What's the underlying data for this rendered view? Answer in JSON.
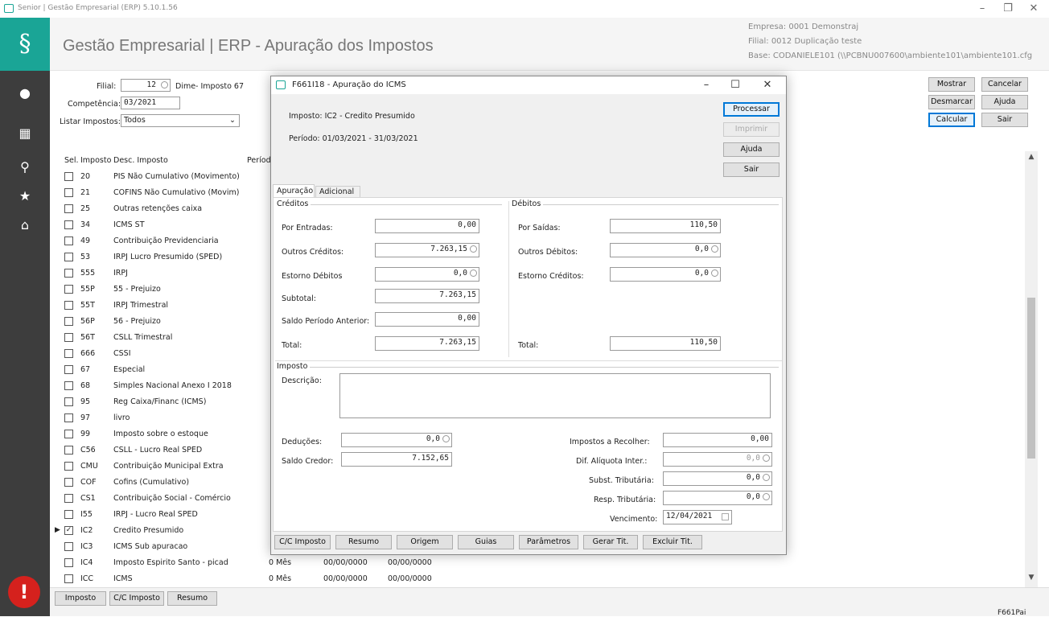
{
  "window": {
    "title": "Senior | Gestão Empresarial (ERP) 5.10.1.56"
  },
  "header": {
    "title": "Gestão Empresarial | ERP - Apuração dos Impostos",
    "empresa": "Empresa: 0001 Demonstraj",
    "filial": "Filial: 0012 Duplicação teste",
    "base": "Base: CODANIELE101 (\\\\PCBNU007600\\ambiente101\\ambiente101.cfg"
  },
  "filters": {
    "filial_label": "Filial:",
    "filial_value": "12",
    "filial_desc": "Dime- Imposto 67",
    "competencia_label": "Competência:",
    "competencia_value": "03/2021",
    "listar_label": "Listar Impostos:",
    "listar_value": "Todos"
  },
  "top_buttons": {
    "mostrar": "Mostrar",
    "cancelar": "Cancelar",
    "desmarcar": "Desmarcar",
    "ajuda": "Ajuda",
    "calcular": "Calcular",
    "sair": "Sair"
  },
  "table": {
    "headers": [
      "Sel.",
      "Imposto",
      "Desc. Imposto",
      "Períod"
    ],
    "rows": [
      {
        "code": "20",
        "desc": "PIS Não Cumulativo (Movimento)",
        "checked": false
      },
      {
        "code": "21",
        "desc": "COFINS Não Cumulativo (Movim)",
        "checked": false
      },
      {
        "code": "25",
        "desc": "Outras retenções caixa",
        "checked": false
      },
      {
        "code": "34",
        "desc": "ICMS ST",
        "checked": false
      },
      {
        "code": "49",
        "desc": "Contribuição Previdenciaria",
        "checked": false
      },
      {
        "code": "53",
        "desc": "IRPJ Lucro Presumido (SPED)",
        "checked": false
      },
      {
        "code": "555",
        "desc": "IRPJ",
        "checked": false
      },
      {
        "code": "55P",
        "desc": "55 - Prejuizo",
        "checked": false
      },
      {
        "code": "55T",
        "desc": "IRPJ Trimestral",
        "checked": false
      },
      {
        "code": "56P",
        "desc": "56 - Prejuizo",
        "checked": false
      },
      {
        "code": "56T",
        "desc": "CSLL Trimestral",
        "checked": false
      },
      {
        "code": "666",
        "desc": "CSSI",
        "checked": false
      },
      {
        "code": "67",
        "desc": "Especial",
        "checked": false
      },
      {
        "code": "68",
        "desc": "Simples Nacional Anexo I 2018",
        "checked": false
      },
      {
        "code": "95",
        "desc": "Reg Caixa/Financ (ICMS)",
        "checked": false
      },
      {
        "code": "97",
        "desc": "livro",
        "checked": false
      },
      {
        "code": "99",
        "desc": "Imposto sobre o estoque",
        "checked": false
      },
      {
        "code": "C56",
        "desc": "CSLL - Lucro Real SPED",
        "checked": false
      },
      {
        "code": "CMU",
        "desc": "Contribuição Municipal Extra",
        "checked": false
      },
      {
        "code": "COF",
        "desc": "Cofins (Cumulativo)",
        "checked": false
      },
      {
        "code": "CS1",
        "desc": "Contribuição Social - Comércio",
        "checked": false
      },
      {
        "code": "I55",
        "desc": "IRPJ  - Lucro Real SPED",
        "checked": false
      },
      {
        "code": "IC2",
        "desc": "Credito Presumido",
        "checked": true
      },
      {
        "code": "IC3",
        "desc": "ICMS Sub apuracao",
        "checked": false
      },
      {
        "code": "IC4",
        "desc": "Imposto Espirito Santo - picad",
        "checked": false,
        "periodo": "0 Mês",
        "d1": "00/00/0000",
        "d2": "00/00/0000"
      },
      {
        "code": "ICC",
        "desc": "ICMS",
        "checked": false,
        "periodo": "0 Mês",
        "d1": "00/00/0000",
        "d2": "00/00/0000"
      }
    ]
  },
  "bottom_buttons": {
    "imposto": "Imposto",
    "cc_imposto": "C/C Imposto",
    "resumo": "Resumo",
    "status_code": "F661Pai"
  },
  "dialog": {
    "title": "F661I18 - Apuração do ICMS",
    "imposto_line": "Imposto: IC2 - Credito Presumido",
    "periodo_line": "Período: 01/03/2021 - 31/03/2021",
    "buttons": {
      "processar": "Processar",
      "imprimir": "Imprimir",
      "ajuda": "Ajuda",
      "sair": "Sair"
    },
    "tabs": [
      "Apuração",
      "Adicional"
    ],
    "creditos": {
      "group": "Créditos",
      "por_entradas_label": "Por Entradas:",
      "por_entradas": "0,00",
      "outros_creditos_label": "Outros Créditos:",
      "outros_creditos": "7.263,15",
      "estorno_debitos_label": "Estorno Débitos",
      "estorno_debitos": "0,0",
      "subtotal_label": "Subtotal:",
      "subtotal": "7.263,15",
      "saldo_anterior_label": "Saldo Período Anterior:",
      "saldo_anterior": "0,00",
      "total_label": "Total:",
      "total": "7.263,15"
    },
    "debitos": {
      "group": "Débitos",
      "por_saidas_label": "Por Saídas:",
      "por_saidas": "110,50",
      "outros_debitos_label": "Outros Débitos:",
      "outros_debitos": "0,0",
      "estorno_creditos_label": "Estorno Créditos:",
      "estorno_creditos": "0,0",
      "total_label": "Total:",
      "total": "110,50"
    },
    "imposto": {
      "group": "Imposto",
      "descricao_label": "Descrição:",
      "deducoes_label": "Deduções:",
      "deducoes": "0,0",
      "saldo_credor_label": "Saldo Credor:",
      "saldo_credor": "7.152,65",
      "recolher_label": "Impostos a Recolher:",
      "recolher": "0,00",
      "dif_aliquota_label": "Dif. Alíquota Inter.:",
      "dif_aliquota": "0,0",
      "subst_label": "Subst. Tributária:",
      "subst": "0,0",
      "resp_label": "Resp. Tributária:",
      "resp": "0,0",
      "vencimento_label": "Vencimento:",
      "vencimento": "12/04/2021"
    },
    "bottom_buttons": [
      "C/C Imposto",
      "Resumo",
      "Origem",
      "Guias",
      "Parâmetros",
      "Gerar Tit.",
      "Excluir Tit."
    ]
  }
}
